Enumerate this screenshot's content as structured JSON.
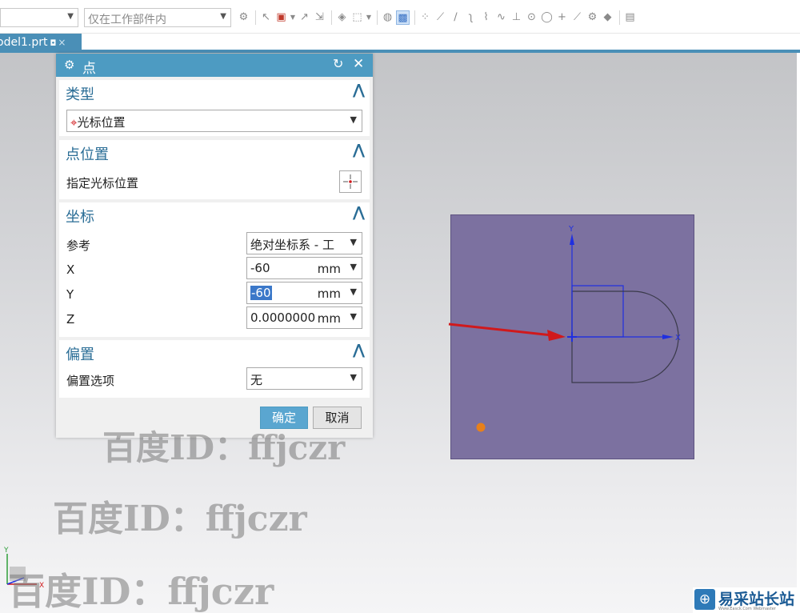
{
  "toolbar": {
    "filter_placeholder": "",
    "scope_select": "仅在工作部件内",
    "tools": [
      "snap",
      "sel-a",
      "sel-b",
      "sel-c",
      "sel-d",
      "sel-e",
      "box",
      "shade",
      "solid",
      "pt-grid",
      "line1",
      "line2",
      "curve",
      "spline1",
      "spline2",
      "junction",
      "circle",
      "circle2",
      "plus",
      "line3",
      "tool1",
      "tool2",
      "tool3"
    ]
  },
  "tab": {
    "label": "odel1.prt",
    "pin": "◘",
    "close": "×"
  },
  "dialog": {
    "title": "点",
    "type_section": {
      "header": "类型",
      "value": "光标位置"
    },
    "point_section": {
      "header": "点位置",
      "label": "指定光标位置"
    },
    "coord_section": {
      "header": "坐标",
      "reference_label": "参考",
      "reference_value": "绝对坐标系 - 工",
      "x_label": "X",
      "x_value": "-60",
      "x_unit": "mm",
      "y_label": "Y",
      "y_value": "-60",
      "y_unit": "mm",
      "z_label": "Z",
      "z_value": "0.0000000",
      "z_unit": "mm"
    },
    "offset_section": {
      "header": "偏置",
      "label": "偏置选项",
      "value": "无"
    },
    "ok_label": "确定",
    "cancel_label": "取消"
  },
  "watermark": {
    "text": "百度ID：ffjczr"
  },
  "sketch": {
    "y_axis_label": "Y",
    "x_axis_label": "X",
    "triad_y_label": "Y",
    "triad_x_label": "X"
  },
  "site_logo": {
    "name": "易采站长站",
    "tagline": "Www.Easck.Com Webmaster"
  },
  "colors": {
    "accent": "#4d9bc2",
    "plane": "#7c71a0",
    "axis": "#1f2fe0",
    "arrow": "#d0191c",
    "selection": "#3b78c9"
  }
}
